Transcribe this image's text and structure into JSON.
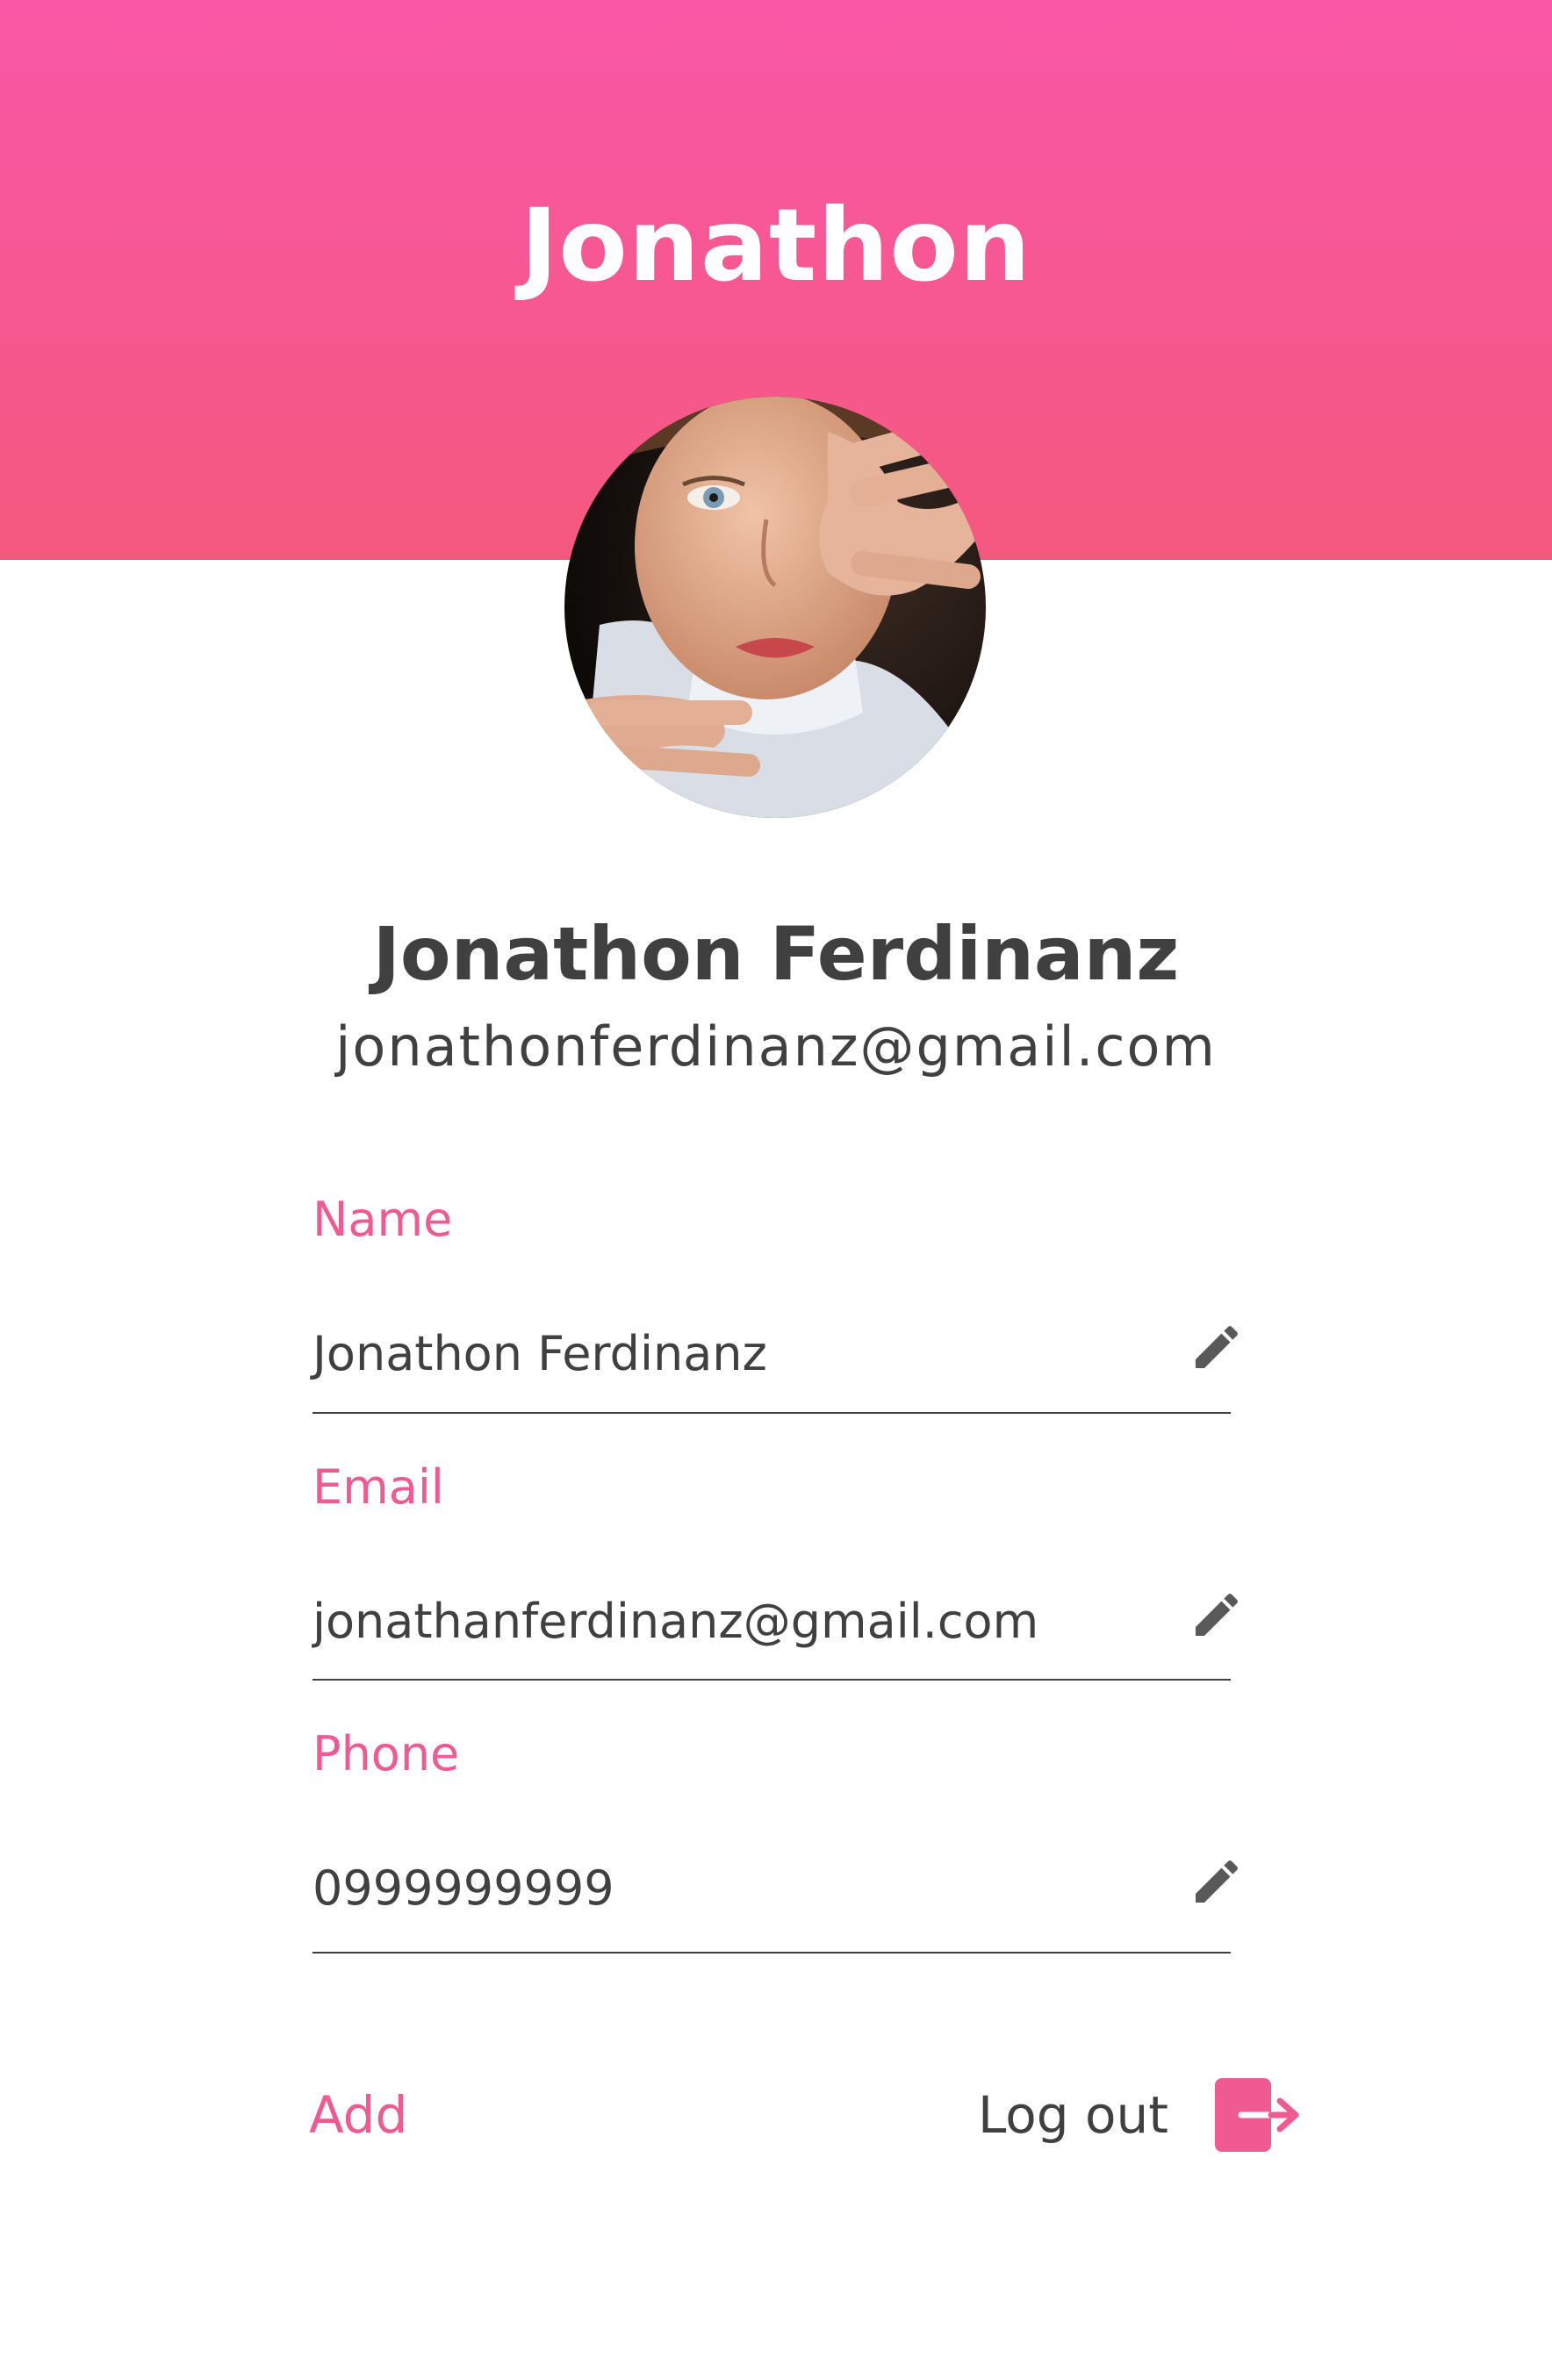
{
  "header": {
    "title": "Jonathon"
  },
  "profile": {
    "full_name": "Jonathon Ferdinanz",
    "email": "jonathonferdinanz@gmail.com"
  },
  "fields": [
    {
      "label": "Name",
      "value": "Jonathon Ferdinanz",
      "icon": "pencil-icon"
    },
    {
      "label": "Email",
      "value": "jonathanferdinanz@gmail.com",
      "icon": "pencil-icon"
    },
    {
      "label": "Phone",
      "value": "0999999999",
      "icon": "pencil-icon"
    }
  ],
  "actions": {
    "add_label": "Add",
    "logout_label": "Log out",
    "logout_icon": "logout-icon"
  },
  "colors": {
    "header_top": "#f957a6",
    "header_bottom": "#f5587f",
    "accent": "#f05a93",
    "text": "#404040"
  }
}
